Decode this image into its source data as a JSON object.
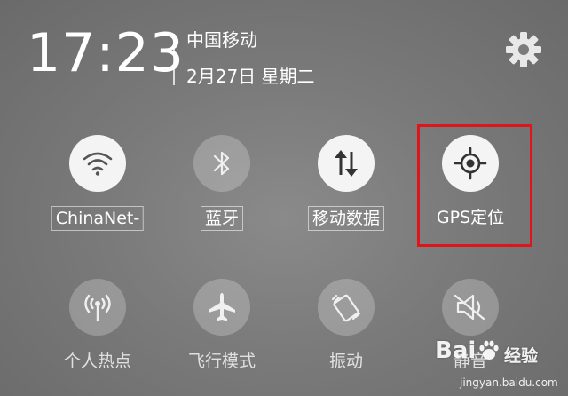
{
  "status": {
    "time": "17:23",
    "carrier": "中国移动",
    "date": "2月27日 星期二"
  },
  "icons": {
    "settings": "gear-icon"
  },
  "toggles": [
    {
      "label": "ChinaNet-",
      "icon": "wifi-icon",
      "state": "on"
    },
    {
      "label": "蓝牙",
      "icon": "bluetooth-icon",
      "state": "off"
    },
    {
      "label": "移动数据",
      "icon": "mobile-data-icon",
      "state": "on"
    },
    {
      "label": "GPS定位",
      "icon": "gps-icon",
      "state": "on"
    },
    {
      "label": "个人热点",
      "icon": "hotspot-icon",
      "state": "off"
    },
    {
      "label": "飞行模式",
      "icon": "airplane-icon",
      "state": "off"
    },
    {
      "label": "振动",
      "icon": "vibrate-icon",
      "state": "off"
    },
    {
      "label": "静音",
      "icon": "mute-icon",
      "state": "off"
    }
  ],
  "colors": {
    "highlight": "#e0141b",
    "active_circle": "#f4f4f4"
  },
  "watermark": {
    "brand": "Bai",
    "text": "经验",
    "url": "jingyan.baidu.com"
  }
}
